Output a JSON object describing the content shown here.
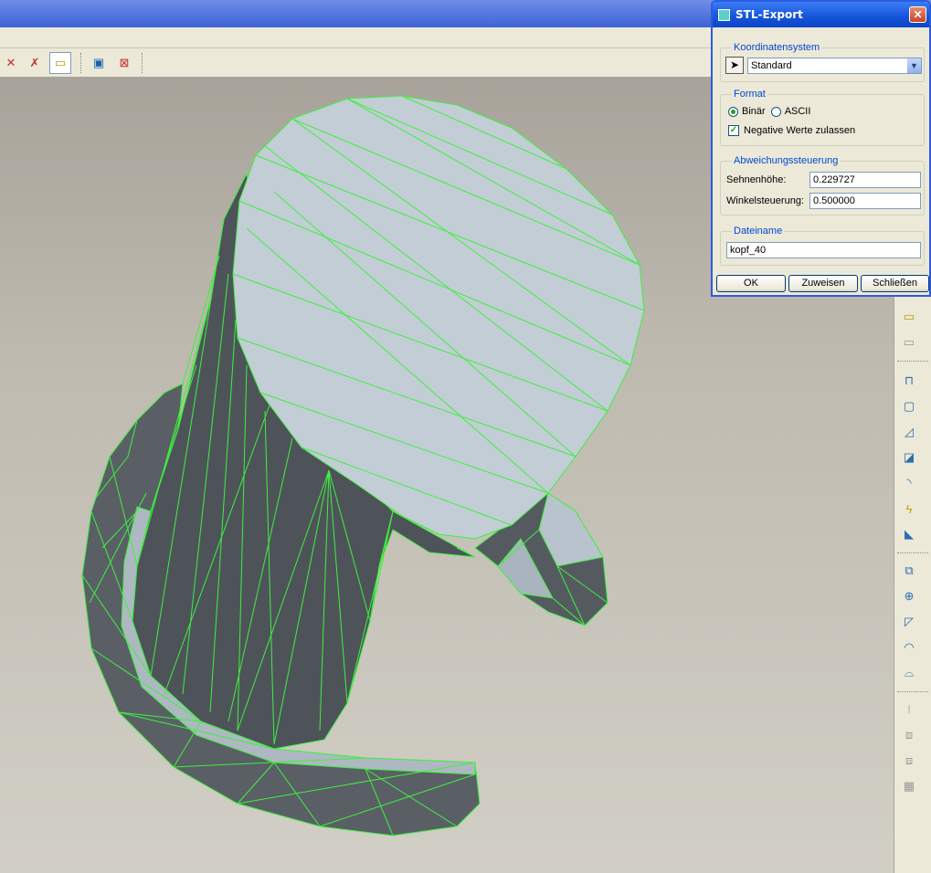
{
  "dialog": {
    "title": "STL-Export",
    "close_glyph": "✕",
    "coordinate_system": {
      "label": "Koordinatensystem",
      "selected": "Standard"
    },
    "format": {
      "label": "Format",
      "binary_label": "Binär",
      "ascii_label": "ASCII",
      "selected": "Binär",
      "negative_values_label": "Negative Werte zulassen",
      "negative_values_checked": true
    },
    "deviation": {
      "label": "Abweichungssteuerung",
      "chord_height_label": "Sehnenhöhe:",
      "chord_height_value": "0.229727",
      "angle_control_label": "Winkelsteuerung:",
      "angle_control_value": "0.500000"
    },
    "filename": {
      "label": "Dateiname",
      "value": "kopf_40"
    },
    "buttons": {
      "ok": "OK",
      "assign": "Zuweisen",
      "close": "Schließen"
    }
  },
  "colors": {
    "mesh_edge": "#3ef03e",
    "top_face": "#c3cdd6",
    "shadow_face": "#50555c",
    "dialog_title": "#1553d8"
  },
  "toolbar_icons": [
    "hide-points-icon",
    "hide-axes-icon",
    "selection-filter-icon",
    "window-check-icon",
    "window-close-icon"
  ],
  "right_toolbar_icons": [
    "selection-filter-icon",
    "selection-filter-2-icon",
    "extrude-icon",
    "shell-icon",
    "draft-icon",
    "rib-icon",
    "round-icon",
    "cosmetic-icon",
    "chamfer-icon",
    "datum-plane-icon",
    "datum-axis-icon",
    "datum-point-icon",
    "curve-icon",
    "surface-icon",
    "mirror-icon",
    "copy-icon",
    "pattern-icon",
    "table-icon"
  ]
}
